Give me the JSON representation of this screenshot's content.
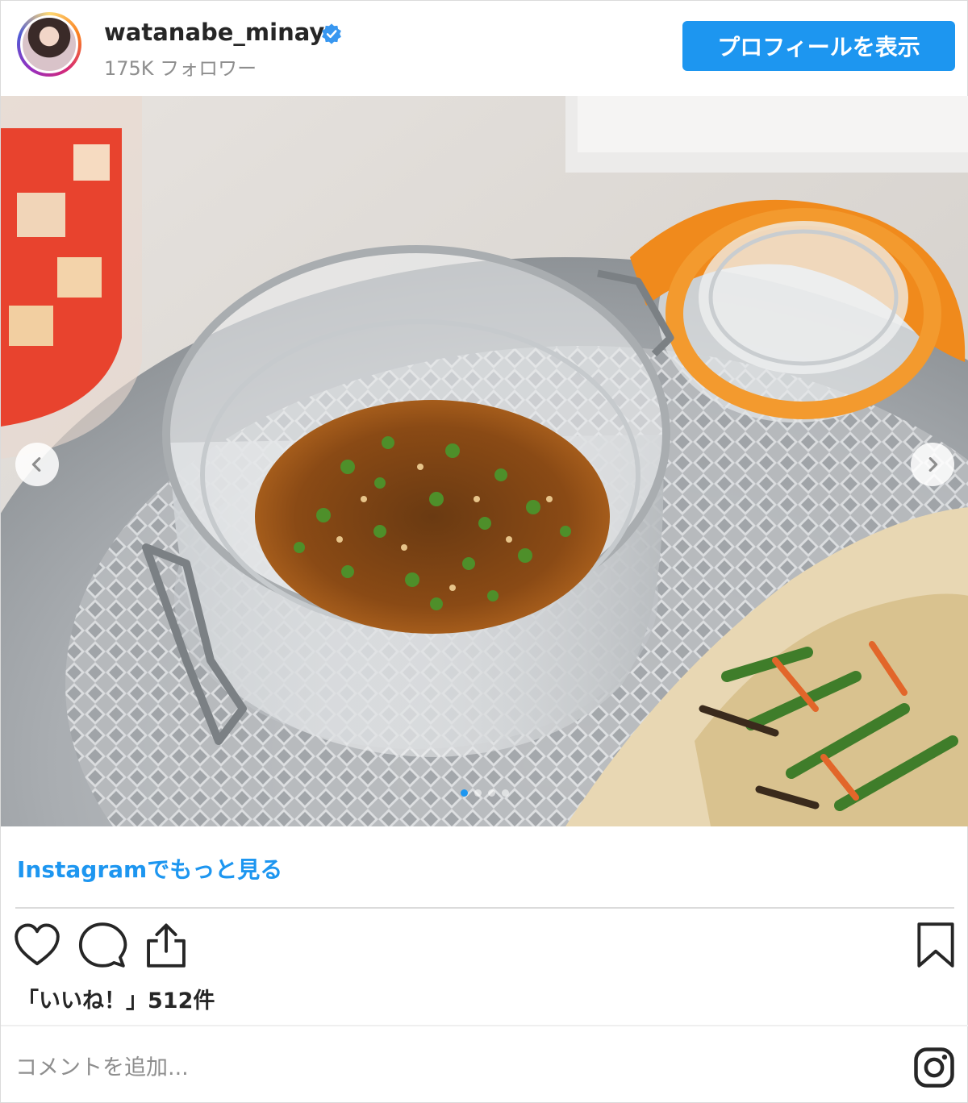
{
  "header": {
    "username": "watanabe_minayo",
    "followers": "175K フォロワー",
    "profile_button": "プロフィールを表示"
  },
  "post": {
    "more_link": "Instagramでもっと見る",
    "likes": "「いいね！」512件",
    "comment_placeholder": "コメントを追加...",
    "carousel_dots": 4,
    "active_dot": 0
  },
  "icons": {
    "like": "heart-icon",
    "comment": "speech-bubble-icon",
    "share": "share-icon",
    "save": "bookmark-icon",
    "instagram": "instagram-logo-icon",
    "verified": "verified-badge-icon",
    "prev": "chevron-left-icon",
    "next": "chevron-right-icon"
  },
  "colors": {
    "accent": "#1d96f0",
    "text": "#262626",
    "muted": "#8e8e8e",
    "divider": "#dbdbdb"
  }
}
